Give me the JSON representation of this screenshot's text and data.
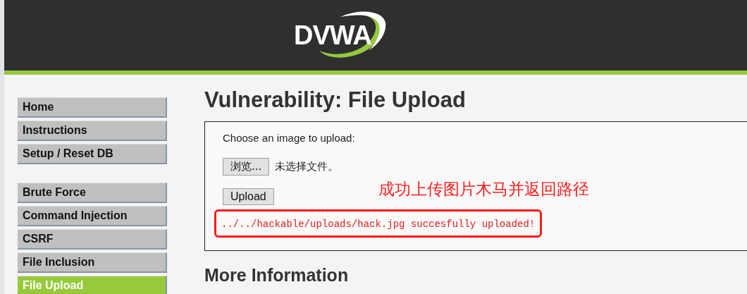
{
  "header": {
    "logo": "DVWA"
  },
  "menu_groups": [
    {
      "items": [
        {
          "label": "Home",
          "selected": false
        },
        {
          "label": "Instructions",
          "selected": false
        },
        {
          "label": "Setup / Reset DB",
          "selected": false
        }
      ]
    },
    {
      "items": [
        {
          "label": "Brute Force",
          "selected": false
        },
        {
          "label": "Command Injection",
          "selected": false
        },
        {
          "label": "CSRF",
          "selected": false
        },
        {
          "label": "File Inclusion",
          "selected": false
        },
        {
          "label": "File Upload",
          "selected": true
        }
      ]
    }
  ],
  "title": "Vulnerability: File Upload",
  "upload_form": {
    "prompt": "Choose an image to upload:",
    "browse_button": "浏览...",
    "file_status": "未选择文件。",
    "upload_button": "Upload",
    "message": "../../hackable/uploads/hack.jpg succesfully uploaded!"
  },
  "annotation": "成功上传图片木马并返回路径",
  "section_heading": "More Information"
}
